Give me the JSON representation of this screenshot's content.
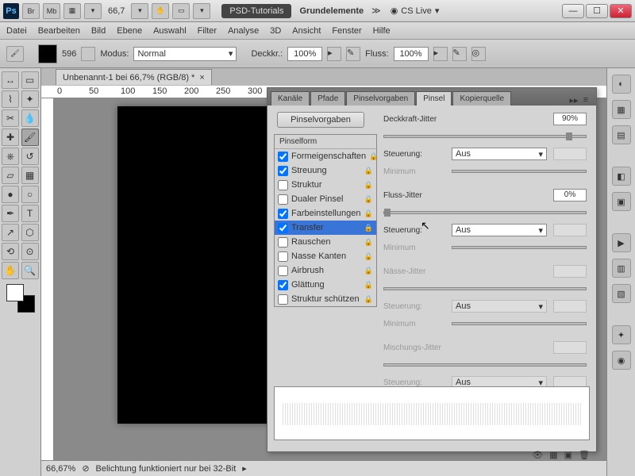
{
  "titlebar": {
    "ps": "Ps",
    "br": "Br",
    "mb": "Mb",
    "zoom": "66,7",
    "workspace": "PSD-Tutorials",
    "workspace2": "Grundelemente",
    "cslive": "CS Live"
  },
  "menu": [
    "Datei",
    "Bearbeiten",
    "Bild",
    "Ebene",
    "Auswahl",
    "Filter",
    "Analyse",
    "3D",
    "Ansicht",
    "Fenster",
    "Hilfe"
  ],
  "optbar": {
    "size": "596",
    "modus_label": "Modus:",
    "modus_value": "Normal",
    "deckk_label": "Deckkr.:",
    "deckk_value": "100%",
    "fluss_label": "Fluss:",
    "fluss_value": "100%"
  },
  "doc_tab": "Unbenannt-1 bei 66,7% (RGB/8) *",
  "ruler_marks": [
    "0",
    "50",
    "100",
    "150",
    "200",
    "250",
    "300"
  ],
  "panel": {
    "tabs": [
      "Kanäle",
      "Pfade",
      "Pinselvorgaben",
      "Pinsel",
      "Kopierquelle"
    ],
    "preset_btn": "Pinselvorgaben",
    "shape_header": "Pinselform",
    "items": [
      {
        "label": "Formeigenschaften",
        "checked": true
      },
      {
        "label": "Streuung",
        "checked": true
      },
      {
        "label": "Struktur",
        "checked": false
      },
      {
        "label": "Dualer Pinsel",
        "checked": false
      },
      {
        "label": "Farbeinstellungen",
        "checked": true
      },
      {
        "label": "Transfer",
        "checked": true,
        "selected": true
      },
      {
        "label": "Rauschen",
        "checked": false
      },
      {
        "label": "Nasse Kanten",
        "checked": false
      },
      {
        "label": "Airbrush",
        "checked": false
      },
      {
        "label": "Glättung",
        "checked": true
      },
      {
        "label": "Struktur schützen",
        "checked": false
      }
    ],
    "r": {
      "opacity_jitter": "Deckkraft-Jitter",
      "opacity_val": "90%",
      "steuerung": "Steuerung:",
      "aus": "Aus",
      "minimum": "Minimum",
      "flow_jitter": "Fluss-Jitter",
      "flow_val": "0%",
      "wet_jitter": "Nässe-Jitter",
      "mix_jitter": "Mischungs-Jitter"
    }
  },
  "status": {
    "zoom": "66,67%",
    "msg": "Belichtung funktioniert nur bei 32-Bit"
  }
}
